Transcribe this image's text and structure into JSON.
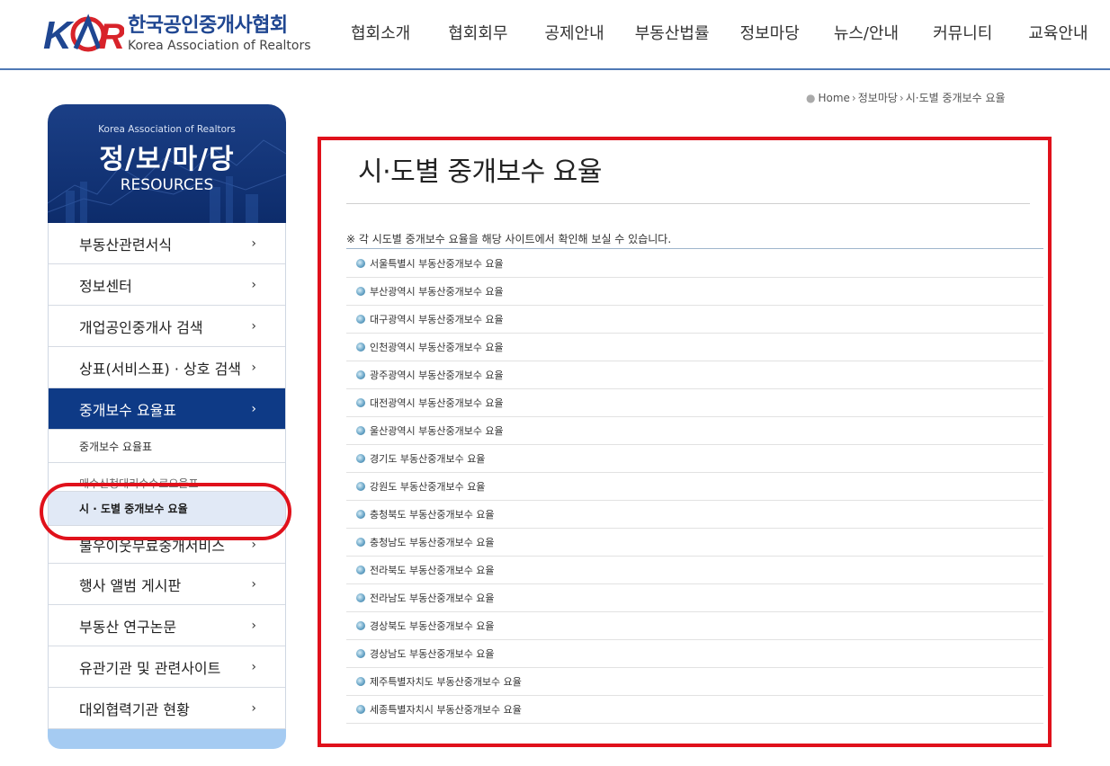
{
  "header": {
    "logo_mark": "KAR",
    "org_name_ko": "한국공인중개사협회",
    "org_name_en": "Korea Association of Realtors",
    "nav": [
      "협회소개",
      "협회회무",
      "공제안내",
      "부동산법률",
      "정보마당",
      "뉴스/안내",
      "커뮤니티",
      "교육안내"
    ],
    "colors": {
      "brand_blue": "#1f4691",
      "brand_red": "#d8232a"
    }
  },
  "breadcrumb": {
    "items": [
      "Home",
      "정보마당",
      "시·도별 중개보수 요율"
    ]
  },
  "sidebar": {
    "banner": {
      "subtitle": "Korea Association of Realtors",
      "title": "정/보/마/당",
      "title_en": "RESOURCES"
    },
    "items": [
      {
        "label": "부동산관련서식",
        "arrow": "›"
      },
      {
        "label": "정보센터",
        "arrow": "›"
      },
      {
        "label": "개업공인중개사 검색",
        "arrow": "›"
      },
      {
        "label": "상표(서비스표) · 상호 검색",
        "arrow": "›"
      },
      {
        "label": "중개보수 요율표",
        "arrow": "›"
      }
    ],
    "subitems": [
      "중개보수 요율표",
      "매수신청대리수수료요율표",
      "시 · 도별 중개보수 요율"
    ],
    "items_after": [
      {
        "label": "불우이웃무료중개서비스",
        "arrow": "›"
      },
      {
        "label": "행사 앨범 게시판",
        "arrow": "›"
      },
      {
        "label": "부동산 연구논문",
        "arrow": "›"
      },
      {
        "label": "유관기관 및 관련사이트",
        "arrow": "›"
      },
      {
        "label": "대외협력기관 현황",
        "arrow": "›"
      }
    ],
    "active_color": "#0e3a86",
    "highlight_color": "#e0111b"
  },
  "main": {
    "title": "시·도별 중개보수 요율",
    "note": "※ 각 시도별 중개보수 요율을 해당 사이트에서 확인해 보실 수 있습니다.",
    "links": [
      "서울특별시 부동산중개보수 요율",
      "부산광역시 부동산중개보수 요율",
      "대구광역시 부동산중개보수 요율",
      "인천광역시 부동산중개보수 요율",
      "광주광역시 부동산중개보수 요율",
      "대전광역시 부동산중개보수 요율",
      "울산광역시 부동산중개보수 요율",
      "경기도 부동산중개보수 요율",
      "강원도 부동산중개보수 요율",
      "충청북도 부동산중개보수 요율",
      "충청남도 부동산중개보수 요율",
      "전라북도 부동산중개보수 요율",
      "전라남도 부동산중개보수 요율",
      "경상북도 부동산중개보수 요율",
      "경상남도 부동산중개보수 요율",
      "제주특별자치도 부동산중개보수 요율",
      "세종특별자치시 부동산중개보수 요율"
    ]
  }
}
